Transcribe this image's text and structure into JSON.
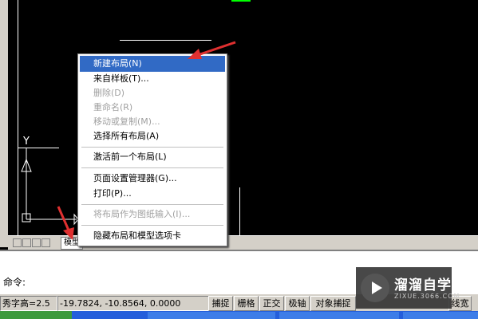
{
  "menu": {
    "items": [
      {
        "label": "新建布局(N)",
        "state": "highlighted"
      },
      {
        "label": "来自样板(T)...",
        "state": "enabled"
      },
      {
        "label": "删除(D)",
        "state": "disabled"
      },
      {
        "label": "重命名(R)",
        "state": "disabled"
      },
      {
        "label": "移动或复制(M)...",
        "state": "disabled"
      },
      {
        "label": "选择所有布局(A)",
        "state": "enabled"
      },
      {
        "label": "激活前一个布局(L)",
        "state": "enabled"
      },
      {
        "label": "页面设置管理器(G)...",
        "state": "enabled"
      },
      {
        "label": "打印(P)...",
        "state": "enabled"
      },
      {
        "label": "将布局作为图纸输入(I)...",
        "state": "disabled"
      },
      {
        "label": "隐藏布局和模型选项卡",
        "state": "enabled"
      }
    ]
  },
  "tabs": {
    "model_tab": "模型"
  },
  "ucs": {
    "y_label": "Y"
  },
  "command": {
    "prompt": "命令:"
  },
  "status": {
    "left_text": "秀字高=2.5",
    "coords": "-19.7824, -10.8564, 0.0000",
    "buttons": [
      "捕捉",
      "栅格",
      "正交",
      "极轴",
      "对象捕捉"
    ],
    "lineweight": "线宽"
  },
  "watermark": {
    "title": "溜溜自学",
    "url": "ZIXUE.3066.COM"
  },
  "colors": {
    "highlight": "#316ac5",
    "arrow": "#e03030",
    "accent_green": "#00ff00"
  }
}
